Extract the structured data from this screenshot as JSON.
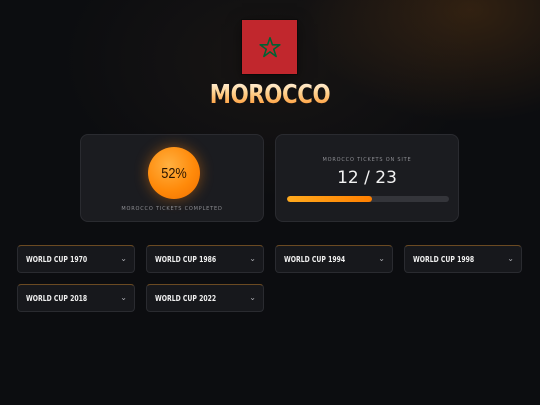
{
  "country": {
    "name": "MOROCCO",
    "flag_colors": {
      "field": "#c1272d",
      "star": "#006233"
    }
  },
  "stats": {
    "completed_percent": "52%",
    "completed_caption": "MOROCCO TICKETS COMPLETED",
    "on_site_caption": "MOROCCO TICKETS ON SITE",
    "on_site_count": "12 / 23",
    "on_site_progress_fraction": 0.5217
  },
  "world_cups": [
    {
      "label": "WORLD CUP 1970",
      "icon": "chevron-down-icon"
    },
    {
      "label": "WORLD CUP 1986",
      "icon": "chevron-down-icon"
    },
    {
      "label": "WORLD CUP 1994",
      "icon": "chevron-down-icon"
    },
    {
      "label": "WORLD CUP 1998",
      "icon": "chevron-down-icon"
    },
    {
      "label": "WORLD CUP 2018",
      "icon": "chevron-down-icon"
    },
    {
      "label": "WORLD CUP 2022",
      "icon": "chevron-down-icon"
    }
  ],
  "colors": {
    "accent": "#ff8a0a",
    "background": "#0c0d10",
    "card": "#1b1c20"
  }
}
